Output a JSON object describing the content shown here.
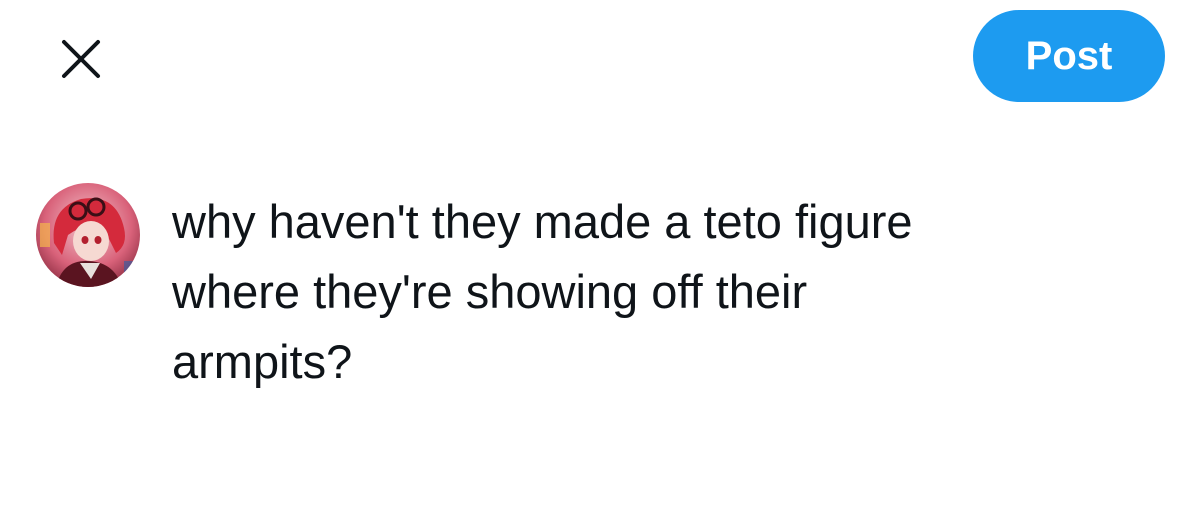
{
  "toolbar": {
    "close_icon": "close-icon",
    "post_label": "Post",
    "accent_color": "#1d9bf0"
  },
  "composer": {
    "avatar_icon": "avatar",
    "text": "why haven't they made a teto figure\nwhere they're showing off their\narmpits?"
  }
}
